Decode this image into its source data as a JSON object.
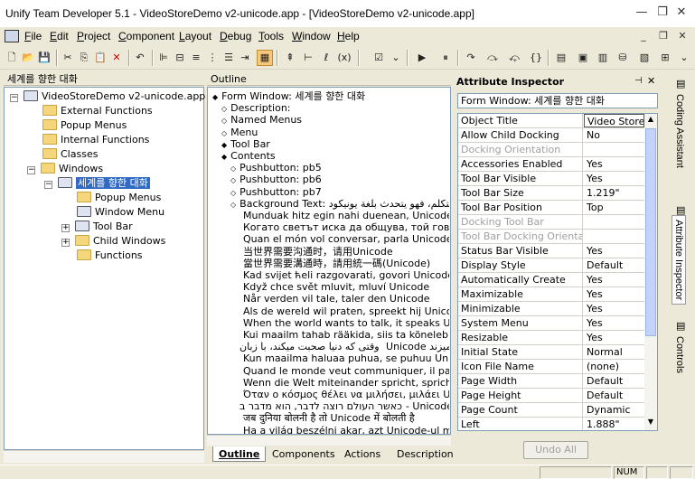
{
  "window": {
    "title": "Unify Team Developer 5.1 - VideoStoreDemo v2-unicode.app - [VideoStoreDemo v2-unicode.app]"
  },
  "menu": [
    {
      "u": "F",
      "rest": "ile"
    },
    {
      "u": "E",
      "rest": "dit"
    },
    {
      "u": "P",
      "rest": "roject"
    },
    {
      "u": "C",
      "rest": "omponent"
    },
    {
      "u": "L",
      "rest": "ayout"
    },
    {
      "u": "D",
      "rest": "ebug"
    },
    {
      "u": "T",
      "rest": "ools"
    },
    {
      "u": "W",
      "rest": "indow"
    },
    {
      "u": "H",
      "rest": "elp"
    }
  ],
  "tree_panel": {
    "title": "세계를 향한 대화",
    "items": [
      {
        "label": "VideoStoreDemo v2-unicode.app",
        "level": 0,
        "box": "−",
        "icon": "app-icon"
      },
      {
        "label": "External Functions",
        "level": 1,
        "icon": "folder-icon"
      },
      {
        "label": "Popup Menus",
        "level": 1,
        "icon": "folder-icon"
      },
      {
        "label": "Internal Functions",
        "level": 1,
        "icon": "folder-icon"
      },
      {
        "label": "Classes",
        "level": 1,
        "icon": "folder-icon"
      },
      {
        "label": "Windows",
        "level": 1,
        "box": "−",
        "icon": "folder-icon"
      },
      {
        "label": "세계를 향한 대화",
        "level": 2,
        "box": "−",
        "icon": "form-window-icon",
        "selected": true
      },
      {
        "label": "Popup Menus",
        "level": 3,
        "icon": "folder-icon"
      },
      {
        "label": "Window Menu",
        "level": 3,
        "icon": "menu-icon"
      },
      {
        "label": "Tool Bar",
        "level": 3,
        "box": "+",
        "icon": "toolbar-icon"
      },
      {
        "label": "Child Windows",
        "level": 3,
        "box": "+",
        "icon": "folder-icon"
      },
      {
        "label": "Functions",
        "level": 3,
        "icon": "folder-icon"
      }
    ]
  },
  "outline_panel": {
    "title": "Outline",
    "lines": [
      {
        "b": "◆",
        "t": "Form Window: 세계를 향한 대화",
        "i": 0
      },
      {
        "b": "◇",
        "t": "Description:",
        "i": 1
      },
      {
        "b": "◇",
        "t": "Named Menus",
        "i": 1
      },
      {
        "b": "◇",
        "t": "Menu",
        "i": 1
      },
      {
        "b": "◆",
        "t": "Tool Bar",
        "i": 1
      },
      {
        "b": "◆",
        "t": "Contents",
        "i": 1
      },
      {
        "b": "◇",
        "t": "Pushbutton: pb5",
        "i": 2
      },
      {
        "b": "◇",
        "t": "Pushbutton: pb6",
        "i": 2
      },
      {
        "b": "◇",
        "t": "Pushbutton: pb7",
        "i": 2
      },
      {
        "b": "◇",
        "t": "Background Text: عندما يريد العالم أن يتكلم، فهو يتحدث بلغة يونيكود",
        "i": 2
      },
      {
        "b": "",
        "t": "Munduak hitz egin nahi duenean, Unicodez hitz e",
        "i": 3
      },
      {
        "b": "",
        "t": "Когато светът иска да общува, той говори на",
        "i": 3
      },
      {
        "b": "",
        "t": "Quan el món vol conversar, parla Unicode",
        "i": 3
      },
      {
        "b": "",
        "t": "当世界需要沟通时，请用Unicode",
        "i": 3
      },
      {
        "b": "",
        "t": "當世界需要溝通時，請用統一碼(Unicode)",
        "i": 3
      },
      {
        "b": "",
        "t": "Kad svijet ћeli razgovarati, govori Unicode",
        "i": 3
      },
      {
        "b": "",
        "t": "Když chce svět mluvit, mluví Unicode",
        "i": 3
      },
      {
        "b": "",
        "t": "Når verden vil tale, taler den Unicode",
        "i": 3
      },
      {
        "b": "",
        "t": "Als de wereld wil praten, spreekt hij Unicode",
        "i": 3
      },
      {
        "b": "",
        "t": "When the world wants to talk, it speaks Unicode",
        "i": 3
      },
      {
        "b": "",
        "t": "Kui maailm tahab rääkida, siis ta kõneleb Unicode",
        "i": 3
      },
      {
        "b": "",
        "t": "وقتی که دنیا صحبت میکند، با زبان Unicode میزند",
        "i": 3
      },
      {
        "b": "",
        "t": "Kun maailma haluaa puhua, se puhuu Unicodea",
        "i": 3
      },
      {
        "b": "",
        "t": "Quand le monde veut communiquer, il parle en Un",
        "i": 3
      },
      {
        "b": "",
        "t": "Wenn die Welt miteinander spricht, spricht sie Un",
        "i": 3
      },
      {
        "b": "",
        "t": "Όταν ο κόσμος θέλει να μιλήσει, μιλάει Unicod",
        "i": 3
      },
      {
        "b": "",
        "t": "כאשר העולם רוצה לדבר, הוא מדבר ב- Unicode",
        "i": 3
      },
      {
        "b": "",
        "t": "जब दुनिया बोलनी है तो Unicode में बोलती है",
        "i": 3
      },
      {
        "b": "",
        "t": "Ha a világ beszélni akar, azt Unicode-ul mondja",
        "i": 3
      }
    ],
    "tabs": [
      "Outline",
      "Components",
      "Actions",
      "Description"
    ]
  },
  "attr_panel": {
    "title": "Attribute Inspector",
    "form": "Form Window: 세계를 향한 대화",
    "rows": [
      {
        "k": "Object Title",
        "v": "Video Store",
        "hdr": true
      },
      {
        "k": "Allow Child Docking",
        "v": "No"
      },
      {
        "k": "Docking Orientation",
        "v": "",
        "dis": true
      },
      {
        "k": "Accessories Enabled",
        "v": "Yes"
      },
      {
        "k": "Tool Bar Visible",
        "v": "Yes"
      },
      {
        "k": "Tool Bar Size",
        "v": "1.219\""
      },
      {
        "k": "Tool Bar Position",
        "v": "Top"
      },
      {
        "k": "Docking Tool Bar",
        "v": "",
        "dis": true
      },
      {
        "k": "Tool Bar Docking Orientatio",
        "v": "",
        "dis": true
      },
      {
        "k": "Status Bar Visible",
        "v": "Yes"
      },
      {
        "k": "Display Style",
        "v": "Default"
      },
      {
        "k": "Automatically Create",
        "v": "Yes"
      },
      {
        "k": "Maximizable",
        "v": "Yes"
      },
      {
        "k": "Minimizable",
        "v": "Yes"
      },
      {
        "k": "System Menu",
        "v": "Yes"
      },
      {
        "k": "Resizable",
        "v": "Yes"
      },
      {
        "k": "Initial State",
        "v": "Normal"
      },
      {
        "k": "Icon File Name",
        "v": "(none)"
      },
      {
        "k": "Page Width",
        "v": "Default"
      },
      {
        "k": "Page Height",
        "v": "Default"
      },
      {
        "k": "Page Count",
        "v": "Dynamic"
      },
      {
        "k": "Left",
        "v": "1.888\""
      }
    ],
    "undo": "Undo All"
  },
  "side_tabs": [
    "Coding Assistant",
    "Attribute Inspector",
    "Controls"
  ],
  "status": {
    "num": "NUM"
  }
}
